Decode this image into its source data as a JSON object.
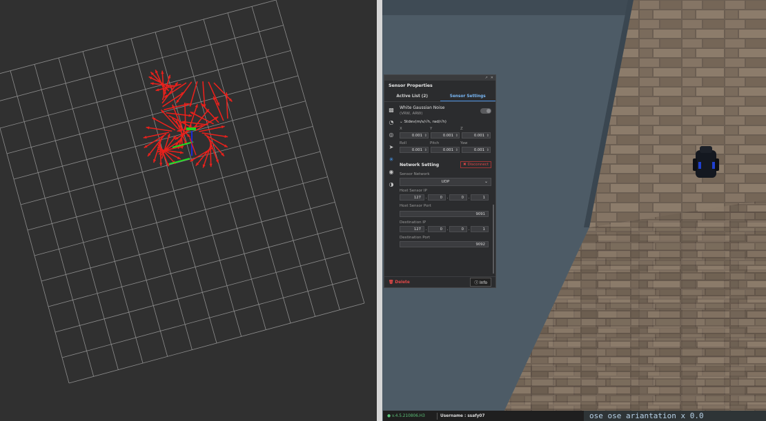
{
  "panel": {
    "title": "Sensor Properties",
    "tabs": [
      "Active List (2)",
      "Sensor Settings"
    ],
    "active_tab": 1,
    "sidebar_icons": [
      "camera-icon",
      "lidar-icon",
      "radio-icon",
      "navigation-icon",
      "imu-icon",
      "radar-icon",
      "antenna-icon"
    ],
    "noise": {
      "label": "White Gaussian Noise",
      "sublabel": "(VRW, ARW)",
      "enabled": false
    },
    "stdev_label": "Stdev(m/s/√h, rad/√h)",
    "xyz_labels": [
      "X",
      "Y",
      "Z"
    ],
    "xyz_values": [
      "0.001",
      "0.001",
      "0.001"
    ],
    "rpy_labels": [
      "Roll",
      "Pitch",
      "Yaw"
    ],
    "rpy_values": [
      "0.001",
      "0.001",
      "0.001"
    ],
    "network": {
      "heading": "Network Setting",
      "disconnect_label": "Disconnect",
      "sensor_network_label": "Sensor Network",
      "protocol": "UDP",
      "host_ip_label": "Host Sensor IP",
      "host_ip": [
        "127",
        "0",
        "0",
        "1"
      ],
      "host_port_label": "Host Sensor Port",
      "host_port": "9091",
      "dest_ip_label": "Destination IP",
      "dest_ip": [
        "127",
        "0",
        "0",
        "1"
      ],
      "dest_port_label": "Destination Port",
      "dest_port": "9092"
    },
    "delete_label": "Delete",
    "info_label": "Info"
  },
  "statusbar": {
    "version": "v.4.5.210806.H3",
    "username": "Username : ssafy07"
  },
  "terminal": {
    "text": "ose ose ariantation x 0.0"
  },
  "colors": {
    "arrow": "#e8211c",
    "accent": "#4a90e2",
    "delete": "#e04848",
    "version": "#5cc37a"
  }
}
